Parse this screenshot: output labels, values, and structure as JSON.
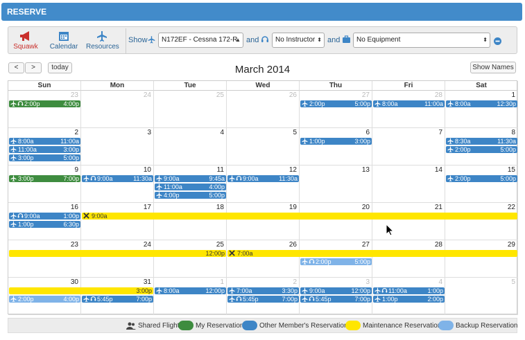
{
  "header": {
    "title": "RESERVE"
  },
  "toolbar": {
    "squawk": "Squawk",
    "calendar": "Calendar",
    "resources": "Resources",
    "show": "Show",
    "and1": "and",
    "and2": "and",
    "aircraft": "N172EF - Cessna 172-R",
    "instructor": "No Instructor",
    "equipment": "No Equipment"
  },
  "nav": {
    "prev": "<",
    "next": ">",
    "today": "today",
    "title": "March 2014",
    "show_names": "Show Names"
  },
  "days": [
    "Sun",
    "Mon",
    "Tue",
    "Wed",
    "Thu",
    "Fri",
    "Sat"
  ],
  "weeks": [
    [
      {
        "n": "23",
        "o": true
      },
      {
        "n": "24",
        "o": true
      },
      {
        "n": "25",
        "o": true
      },
      {
        "n": "26",
        "o": true
      },
      {
        "n": "27",
        "o": true
      },
      {
        "n": "28",
        "o": true
      },
      {
        "n": "1"
      }
    ],
    [
      {
        "n": "2"
      },
      {
        "n": "3"
      },
      {
        "n": "4"
      },
      {
        "n": "5"
      },
      {
        "n": "6"
      },
      {
        "n": "7"
      },
      {
        "n": "8"
      }
    ],
    [
      {
        "n": "9"
      },
      {
        "n": "10"
      },
      {
        "n": "11"
      },
      {
        "n": "12"
      },
      {
        "n": "13"
      },
      {
        "n": "14"
      },
      {
        "n": "15"
      }
    ],
    [
      {
        "n": "16"
      },
      {
        "n": "17"
      },
      {
        "n": "18"
      },
      {
        "n": "19"
      },
      {
        "n": "20"
      },
      {
        "n": "21"
      },
      {
        "n": "22"
      }
    ],
    [
      {
        "n": "23"
      },
      {
        "n": "24"
      },
      {
        "n": "25"
      },
      {
        "n": "26"
      },
      {
        "n": "27"
      },
      {
        "n": "28"
      },
      {
        "n": "29"
      }
    ],
    [
      {
        "n": "30"
      },
      {
        "n": "31"
      },
      {
        "n": "1",
        "o": true
      },
      {
        "n": "2",
        "o": true
      },
      {
        "n": "3",
        "o": true
      },
      {
        "n": "4",
        "o": true
      },
      {
        "n": "5",
        "o": true
      }
    ]
  ],
  "events": [
    {
      "w": 0,
      "d": 0,
      "span": 1,
      "slot": 0,
      "t": "my",
      "start": "2:00p",
      "end": "4:00p",
      "instr": true
    },
    {
      "w": 0,
      "d": 4,
      "span": 1,
      "slot": 0,
      "t": "ot",
      "start": "2:00p",
      "end": "5:00p"
    },
    {
      "w": 0,
      "d": 5,
      "span": 1,
      "slot": 0,
      "t": "ot",
      "start": "8:00a",
      "end": "11:00a"
    },
    {
      "w": 0,
      "d": 6,
      "span": 1,
      "slot": 0,
      "t": "ot",
      "start": "8:00a",
      "end": "12:30p"
    },
    {
      "w": 1,
      "d": 0,
      "span": 1,
      "slot": 0,
      "t": "ot",
      "start": "8:00a",
      "end": "11:00a"
    },
    {
      "w": 1,
      "d": 0,
      "span": 1,
      "slot": 1,
      "t": "ot",
      "start": "11:00a",
      "end": "3:00p"
    },
    {
      "w": 1,
      "d": 0,
      "span": 1,
      "slot": 2,
      "t": "ot",
      "start": "3:00p",
      "end": "5:00p"
    },
    {
      "w": 1,
      "d": 4,
      "span": 1,
      "slot": 0,
      "t": "ot",
      "start": "1:00p",
      "end": "3:00p"
    },
    {
      "w": 1,
      "d": 6,
      "span": 1,
      "slot": 0,
      "t": "ot",
      "start": "8:30a",
      "end": "11:30a"
    },
    {
      "w": 1,
      "d": 6,
      "span": 1,
      "slot": 1,
      "t": "ot",
      "start": "2:00p",
      "end": "5:00p"
    },
    {
      "w": 2,
      "d": 0,
      "span": 1,
      "slot": 0,
      "t": "my",
      "start": "3:00p",
      "end": "7:00p"
    },
    {
      "w": 2,
      "d": 1,
      "span": 1,
      "slot": 0,
      "t": "ot",
      "start": "9:00a",
      "end": "11:30a",
      "instr": true
    },
    {
      "w": 2,
      "d": 2,
      "span": 1,
      "slot": 0,
      "t": "ot",
      "start": "9:00a",
      "end": "9:45a"
    },
    {
      "w": 2,
      "d": 2,
      "span": 1,
      "slot": 1,
      "t": "ot",
      "start": "11:00a",
      "end": "4:00p"
    },
    {
      "w": 2,
      "d": 2,
      "span": 1,
      "slot": 2,
      "t": "ot",
      "start": "4:00p",
      "end": "5:00p"
    },
    {
      "w": 2,
      "d": 3,
      "span": 1,
      "slot": 0,
      "t": "ot",
      "start": "9:00a",
      "end": "11:30a",
      "instr": true
    },
    {
      "w": 2,
      "d": 6,
      "span": 1,
      "slot": 0,
      "t": "ot",
      "start": "2:00p",
      "end": "5:00p"
    },
    {
      "w": 3,
      "d": 0,
      "span": 1,
      "slot": 0,
      "t": "ot",
      "start": "9:00a",
      "end": "1:00p",
      "instr": true
    },
    {
      "w": 3,
      "d": 0,
      "span": 1,
      "slot": 1,
      "t": "ot",
      "start": "1:00p",
      "end": "6:30p"
    },
    {
      "w": 3,
      "d": 1,
      "span": 6,
      "slot": 0,
      "t": "mn",
      "start": "9:00a",
      "end": "",
      "tool": true
    },
    {
      "w": 4,
      "d": 0,
      "span": 3,
      "slot": 0,
      "t": "mn",
      "start": "",
      "end": "12:00p"
    },
    {
      "w": 4,
      "d": 3,
      "span": 4,
      "slot": 0,
      "t": "mn",
      "start": "7:00a",
      "end": "",
      "tool": true
    },
    {
      "w": 4,
      "d": 4,
      "span": 1,
      "slot": 1,
      "t": "bk",
      "start": "2:00p",
      "end": "5:00p",
      "instr": true
    },
    {
      "w": 5,
      "d": 0,
      "span": 2,
      "slot": 0,
      "t": "mn",
      "start": "",
      "end": "3:00p"
    },
    {
      "w": 5,
      "d": 0,
      "span": 1,
      "slot": 1,
      "t": "bk",
      "start": "2:00p",
      "end": "4:00p"
    },
    {
      "w": 5,
      "d": 1,
      "span": 1,
      "slot": 1,
      "t": "ot",
      "start": "5:45p",
      "end": "7:00p",
      "instr": true
    },
    {
      "w": 5,
      "d": 2,
      "span": 1,
      "slot": 0,
      "t": "ot",
      "start": "8:00a",
      "end": "12:00p"
    },
    {
      "w": 5,
      "d": 3,
      "span": 1,
      "slot": 0,
      "t": "ot",
      "start": "7:00a",
      "end": "3:30p"
    },
    {
      "w": 5,
      "d": 3,
      "span": 1,
      "slot": 1,
      "t": "ot",
      "start": "5:45p",
      "end": "7:00p",
      "instr": true
    },
    {
      "w": 5,
      "d": 4,
      "span": 1,
      "slot": 0,
      "t": "ot",
      "start": "9:00a",
      "end": "12:00p"
    },
    {
      "w": 5,
      "d": 4,
      "span": 1,
      "slot": 1,
      "t": "ot",
      "start": "5:45p",
      "end": "7:00p",
      "instr": true
    },
    {
      "w": 5,
      "d": 5,
      "span": 1,
      "slot": 0,
      "t": "ot",
      "start": "11:00a",
      "end": "1:00p",
      "instr": true
    },
    {
      "w": 5,
      "d": 5,
      "span": 1,
      "slot": 1,
      "t": "ot",
      "start": "1:00p",
      "end": "2:00p"
    }
  ],
  "legend": {
    "shared": "Shared Flight",
    "my": "My Reservation",
    "other": "Other Member's Reservation",
    "maint": "Maintenance Reservation",
    "backup": "Backup Reservation"
  },
  "colors": {
    "my": "#3e8c3f",
    "other": "#3d85c6",
    "maint": "#ffe600",
    "backup": "#7fb3e8",
    "header": "#428bca"
  }
}
